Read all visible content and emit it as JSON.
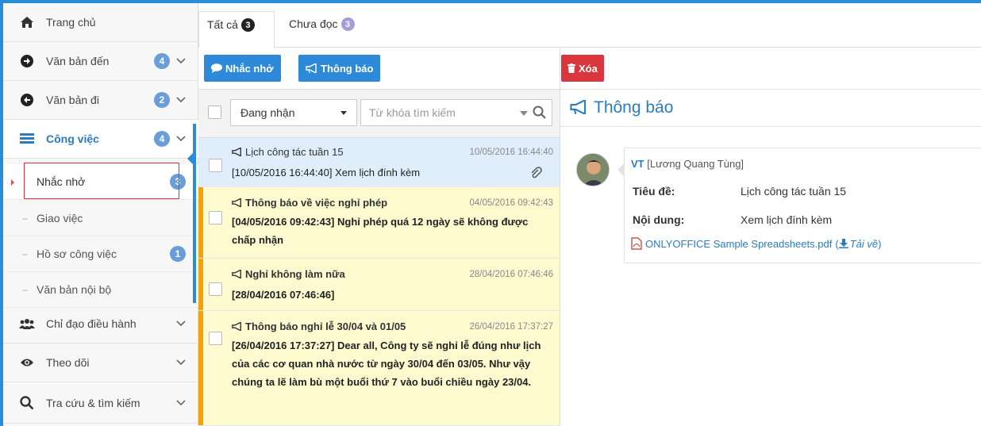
{
  "sidebar": {
    "items": [
      {
        "label": "Trang chủ",
        "icon": "home-icon"
      },
      {
        "label": "Văn bản đến",
        "icon": "arrow-circle-right-icon",
        "badge": "4"
      },
      {
        "label": "Văn bản đi",
        "icon": "arrow-circle-left-icon",
        "badge": "2"
      },
      {
        "label": "Công việc",
        "icon": "tasks-icon",
        "badge": "4"
      },
      {
        "label": "Chỉ đạo điều hành",
        "icon": "users-icon"
      },
      {
        "label": "Theo dõi",
        "icon": "eye-icon"
      },
      {
        "label": "Tra cứu & tìm kiếm",
        "icon": "search-icon"
      }
    ],
    "sub_items": [
      {
        "label": "Nhắc nhở",
        "badge": "3"
      },
      {
        "label": "Giao việc"
      },
      {
        "label": "Hồ sơ công việc",
        "badge": "1"
      },
      {
        "label": "Văn bản nội bộ"
      }
    ]
  },
  "tabs": {
    "all_label": "Tất cả",
    "all_count": "3",
    "unread_label": "Chưa đọc",
    "unread_count": "3"
  },
  "toolbar": {
    "remind_label": "Nhắc nhở",
    "notify_label": "Thông báo",
    "delete_label": "Xóa"
  },
  "filter": {
    "status_value": "Đang nhận",
    "search_placeholder": "Từ khóa tìm kiếm"
  },
  "messages": [
    {
      "title": "Lịch công tác tuần 15",
      "time": "10/05/2016 16:44:40",
      "body": "[10/05/2016 16:44:40] Xem lịch đính kèm",
      "has_attachment": true
    },
    {
      "title": "Thông báo về việc nghỉ phép",
      "time": "04/05/2016 09:42:43",
      "body": "[04/05/2016 09:42:43] Nghỉ phép quá 12 ngày sẽ không được chấp nhận"
    },
    {
      "title": "Nghỉ không làm nữa",
      "time": "28/04/2016 07:46:46",
      "body": "[28/04/2016 07:46:46]"
    },
    {
      "title": "Thông báo nghỉ lễ 30/04 và 01/05",
      "time": "26/04/2016 17:37:27",
      "body": "[26/04/2016 17:37:27] Dear all, Công ty sẽ nghỉ lễ đúng như lịch của các cơ quan nhà nước từ ngày 30/04 đến 03/05. Như vậy chúng ta lẽ làm bù một buổi thứ 7 vào buổi chiều ngày 23/04."
    }
  ],
  "detail": {
    "heading": "Thông báo",
    "author_short": "VT",
    "author_full": "[Lương Quang Tùng]",
    "subject_label": "Tiêu đề:",
    "subject_value": "Lịch công tác tuần 15",
    "content_label": "Nội dung:",
    "content_value": "Xem lịch đính kèm",
    "attachment_name": "ONLYOFFICE Sample Spreadsheets.pdf",
    "download_label": "Tải về"
  },
  "colors": {
    "accent": "#2b8cd8",
    "danger": "#d9363e",
    "unread_bg": "#fdfad0",
    "selected_bg": "#dfeefa",
    "stripe": "#f0a30a"
  }
}
